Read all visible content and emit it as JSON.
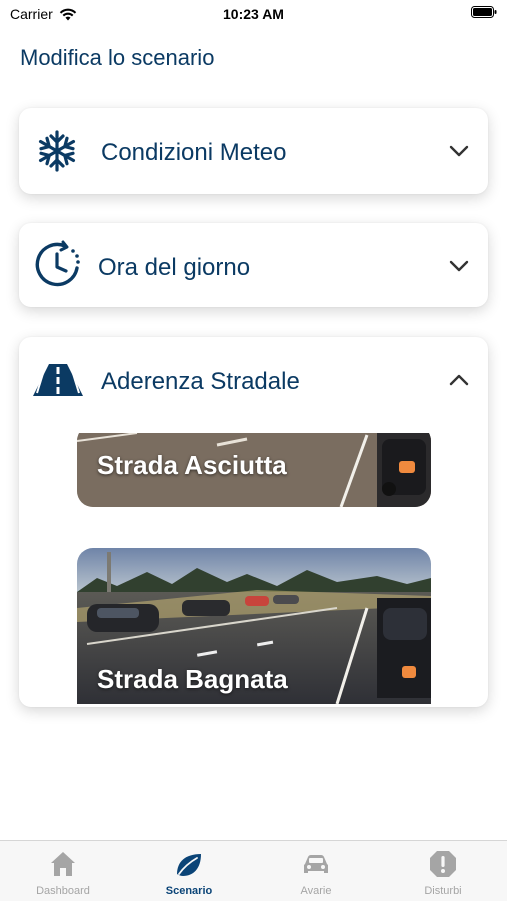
{
  "status_bar": {
    "carrier": "Carrier",
    "time": "10:23 AM"
  },
  "page_title": "Modifica lo scenario",
  "sections": [
    {
      "title": "Condizioni Meteo",
      "icon": "snowflake-icon",
      "expanded": false
    },
    {
      "title": "Ora del giorno",
      "icon": "clock-icon",
      "expanded": false
    },
    {
      "title": "Aderenza Stradale",
      "icon": "road-icon",
      "expanded": true,
      "options": [
        {
          "label": "Strada Asciutta"
        },
        {
          "label": "Strada Bagnata"
        }
      ]
    }
  ],
  "tab_bar": {
    "tabs": [
      {
        "label": "Dashboard",
        "icon": "home-icon",
        "active": false
      },
      {
        "label": "Scenario",
        "icon": "leaf-icon",
        "active": true
      },
      {
        "label": "Avarie",
        "icon": "car-icon",
        "active": false
      },
      {
        "label": "Disturbi",
        "icon": "alert-icon",
        "active": false
      }
    ]
  },
  "colors": {
    "primary": "#0b3a63",
    "tab_active": "#0b4477",
    "tab_inactive": "#a5a5a5"
  }
}
